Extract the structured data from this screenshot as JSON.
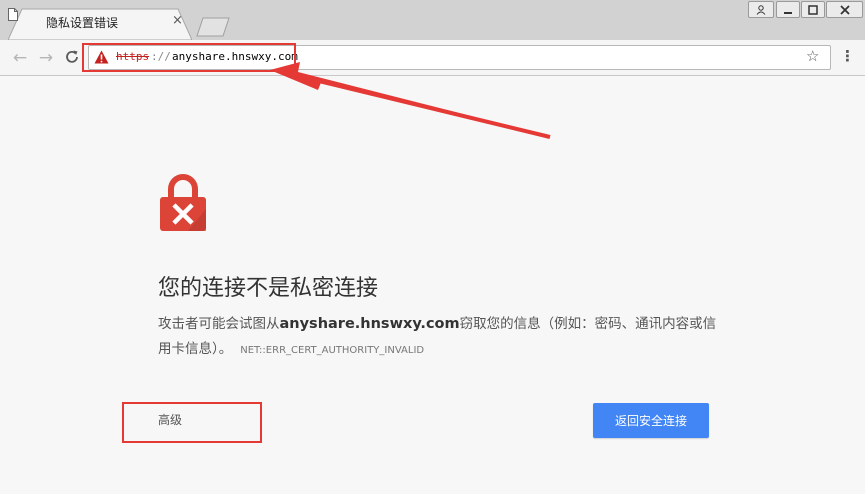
{
  "window": {
    "tab_title": "隐私设置错误",
    "tab_close": "×",
    "user_icon": "user-icon",
    "minimize_icon": "minimize-icon",
    "maximize_icon": "maximize-icon",
    "close_icon": "close-icon"
  },
  "toolbar": {
    "back_glyph": "←",
    "forward_glyph": "→",
    "reload_glyph": "C",
    "url_scheme": "https",
    "url_sep": "://",
    "url_host": "anyshare.hnswxy.com",
    "star_glyph": "☆",
    "menu_glyph": "⋮"
  },
  "page": {
    "title": "您的连接不是私密连接",
    "desc_prefix": "攻击者可能会试图从",
    "desc_host": "anyshare.hnswxy.com",
    "desc_suffix": "窃取您的信息（例如：密码、通讯内容或信用卡信息）。",
    "error_code": "NET::ERR_CERT_AUTHORITY_INVALID",
    "advanced_label": "高级",
    "back_to_safety_label": "返回安全连接"
  },
  "colors": {
    "accent_blue": "#4285f4",
    "lock_red": "#db4437",
    "annotation_red": "#e53935"
  }
}
